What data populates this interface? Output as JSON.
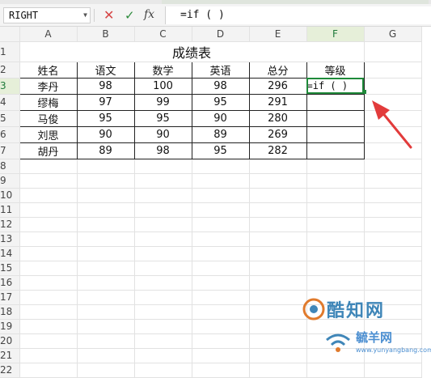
{
  "formula_bar": {
    "name_box": "RIGHT",
    "cancel_glyph": "✕",
    "enter_glyph": "✓",
    "fx_label": "fx",
    "formula": "=if ( )"
  },
  "columns": [
    "A",
    "B",
    "C",
    "D",
    "E",
    "F",
    "G"
  ],
  "rows": [
    "1",
    "2",
    "3",
    "4",
    "5",
    "6",
    "7",
    "8",
    "9",
    "10",
    "11",
    "12",
    "13",
    "14",
    "15",
    "16",
    "17",
    "18",
    "19",
    "20",
    "21",
    "22"
  ],
  "sheet": {
    "title": "成绩表",
    "headers": [
      "姓名",
      "语文",
      "数学",
      "英语",
      "总分",
      "等级"
    ],
    "records": [
      [
        "李丹",
        "98",
        "100",
        "98",
        "296"
      ],
      [
        "缪梅",
        "97",
        "99",
        "95",
        "291"
      ],
      [
        "马俊",
        "95",
        "95",
        "90",
        "280"
      ],
      [
        "刘思",
        "90",
        "90",
        "89",
        "269"
      ],
      [
        "胡丹",
        "89",
        "98",
        "95",
        "282"
      ]
    ],
    "active_cell_value": "=if ( )"
  },
  "selection": {
    "column": "F",
    "row": "3"
  },
  "colors": {
    "accent": "#1f8a3a",
    "arrow": "#e23b3b"
  },
  "watermark": {
    "line1": "酷知网",
    "line2": "毓羊网",
    "url": "www.yunyangbang.com"
  }
}
